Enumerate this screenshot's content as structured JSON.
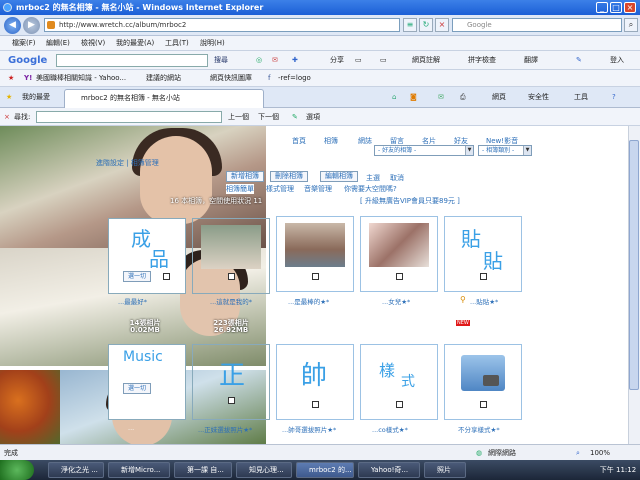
{
  "window": {
    "title": "mrboc2 的無名相簿 - 無名小站 - Windows Internet Explorer"
  },
  "address": {
    "url": "http://www.wretch.cc/album/mrboc2",
    "search_placeholder": "Google"
  },
  "menu": [
    "檔案(F)",
    "編輯(E)",
    "檢視(V)",
    "我的最愛(A)",
    "工具(T)",
    "說明(H)"
  ],
  "google_toolbar": {
    "logo": "Google",
    "search": "搜尋",
    "share": "分享",
    "pagerank": "網頁註解",
    "spell": "拼字檢查",
    "translate": "翻譯",
    "login": "登入"
  },
  "favorites": {
    "items": [
      "美國職棒相關知識 - Yahoo...",
      "建議的網站",
      "網頁快訊圖庫",
      "-ref=logo"
    ]
  },
  "tabs": {
    "fav_label": "我的最愛",
    "active": "mrboc2 的無名相簿 - 無名小站",
    "page": "網頁",
    "security": "安全性",
    "tools": "工具"
  },
  "find": {
    "label": "尋找:",
    "prev": "上一個",
    "next": "下一個",
    "options": "選項"
  },
  "album": {
    "nav": [
      "首頁",
      "相簿",
      "網誌",
      "留言",
      "名片",
      "好友",
      "New!影音"
    ],
    "friend_dropdown": "- 好友的相簿 -",
    "category_dropdown": "- 相簿類別 -",
    "left_link1": "進階設定 | 相簿管理",
    "btn_new": "新增相簿",
    "btn_delete": "刪除相簿",
    "btn_edit": "編輯相簿",
    "main": "主選",
    "cancel": "取消",
    "admin_links": [
      "相簿簡單",
      "樣式管理",
      "音樂管理",
      "你需要大空間嗎?"
    ],
    "usage": "16 本相簿，空間使用狀況 11",
    "upgrade": "[ 升級無廣告VIP會員只要89元 ]",
    "select_label": "選一切",
    "new_badge": "NEW",
    "cards_row1": [
      {
        "caption": "...最最好*",
        "type": "text",
        "letters": [
          "成",
          "品"
        ],
        "count": "14張相片",
        "size": "0.02MB"
      },
      {
        "caption": "...這就是我的*",
        "type": "photo",
        "count": "223張相片",
        "size": "26.92MB"
      },
      {
        "caption": "...是最棒的★*",
        "type": "photo"
      },
      {
        "caption": "...女兒★*",
        "type": "photo"
      },
      {
        "caption": "...貼貼★*",
        "type": "text",
        "letters": [
          "貼",
          "貼"
        ]
      }
    ],
    "cards_row2": [
      {
        "caption": "...",
        "type": "text",
        "letters": [
          "Music"
        ]
      },
      {
        "caption": "...正妹選拔照片★*",
        "type": "text",
        "letters": [
          "正"
        ]
      },
      {
        "caption": "...帥哥選拔照片★*",
        "type": "text",
        "letters": [
          "帥"
        ]
      },
      {
        "caption": "...co樣式★*",
        "type": "text",
        "letters": [
          "樣",
          "式"
        ]
      },
      {
        "caption": "不分享樣式★*",
        "type": "folder"
      }
    ]
  },
  "status": {
    "left": "完成",
    "zone": "網際網路",
    "zoom": "100%"
  },
  "taskbar": {
    "items": [
      "淨化之光 ...",
      "新增Micro...",
      "第一課 自...",
      "知見心理...",
      "mrboc2 的...",
      "Yahoo!奇...",
      "照片"
    ],
    "clock": "下午 11:12"
  }
}
